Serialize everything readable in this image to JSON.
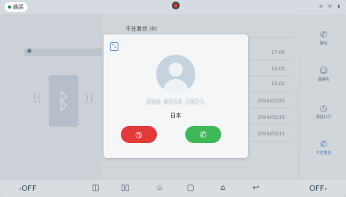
{
  "statusbar": {
    "call_pill": "通話",
    "icons": "✲ ᯤ ▮"
  },
  "background": {
    "list_title": "不在着信 (6)",
    "rows": [
      {
        "time": "17:06"
      },
      {
        "time": "15:03"
      },
      {
        "time": "15:02"
      },
      {
        "time": "2024/03/20"
      },
      {
        "time": "2024/03/19"
      },
      {
        "time": "2024/03/13"
      }
    ],
    "nav": [
      {
        "label": "発信",
        "icon": "phone-icon"
      },
      {
        "label": "連絡先",
        "icon": "person-icon"
      },
      {
        "label": "通話ログ",
        "icon": "clock-icon"
      },
      {
        "label": "不在着信",
        "icon": "missed-call-icon"
      }
    ]
  },
  "dialog": {
    "caller_number": "090 8550 2821",
    "caller_region": "日本"
  },
  "bottom_bar": {
    "left_label": "OFF",
    "right_label": "OFF"
  },
  "colors": {
    "decline": "#e23a3a",
    "accept": "#3fb957",
    "accent": "#3b74c4"
  }
}
